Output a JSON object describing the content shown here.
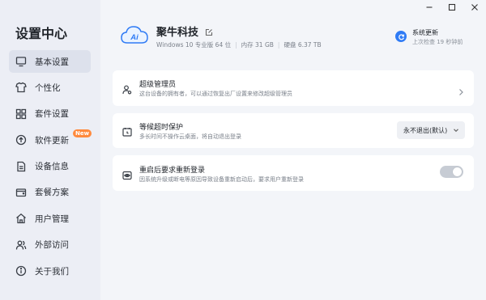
{
  "sidebar": {
    "title": "设置中心",
    "items": [
      {
        "label": "基本设置",
        "icon": "monitor-icon"
      },
      {
        "label": "个性化",
        "icon": "shirt-icon"
      },
      {
        "label": "套件设置",
        "icon": "grid-icon"
      },
      {
        "label": "软件更新",
        "icon": "arrow-up-circle-icon",
        "badge": "New"
      },
      {
        "label": "设备信息",
        "icon": "document-icon"
      },
      {
        "label": "套餐方案",
        "icon": "wallet-icon"
      },
      {
        "label": "用户管理",
        "icon": "home-icon"
      },
      {
        "label": "外部访问",
        "icon": "users-icon"
      },
      {
        "label": "关于我们",
        "icon": "info-icon"
      }
    ],
    "active_index": 0
  },
  "header": {
    "logo_text": "Ai",
    "company_name": "聚牛科技",
    "os": "Windows 10 专业版 64 位",
    "memory": "内存 31 GB",
    "disk": "硬盘 6.37 TB",
    "separator": "|"
  },
  "update": {
    "title": "系统更新",
    "subtitle": "上次检查 19 秒钟前"
  },
  "cards": {
    "admin": {
      "title": "超级管理员",
      "desc": "这台设备的拥有者，可以通过恢复出厂设置来修改超级管理员"
    },
    "timeout": {
      "title": "等候超时保护",
      "desc": "多长时间不操作云桌面，将自动退出登录",
      "select_value": "永不退出(默认)"
    },
    "relogin": {
      "title": "重启后要求重新登录",
      "desc": "因系统升级或断电等原因导致设备重新启动后，要求用户重新登录",
      "toggle_on": false
    }
  },
  "colors": {
    "accent": "#2f7bf5",
    "badge": "#ff8a3d",
    "sidebar_bg": "#eceef5",
    "main_bg": "#f3f5f9"
  }
}
